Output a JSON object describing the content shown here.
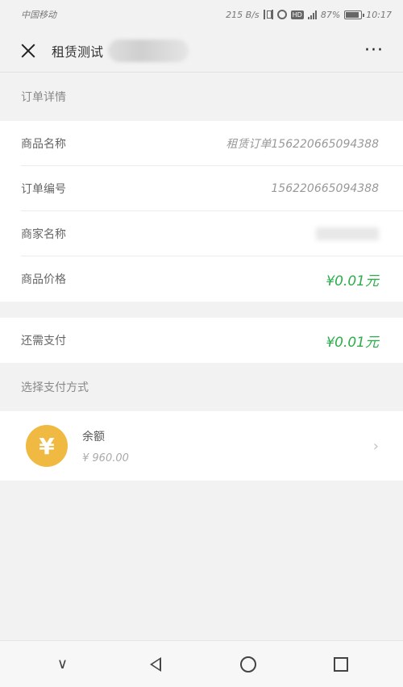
{
  "statusbar": {
    "carrier": "中国移动",
    "speed": "215 B/s",
    "battery": "87%",
    "time": "10:17",
    "icons": [
      "vibrate-icon",
      "alarm-icon",
      "hd-icon",
      "signal-icon",
      "battery-icon"
    ]
  },
  "titlebar": {
    "title": "租赁测试",
    "close_icon": "close-icon",
    "more_label": "···"
  },
  "order": {
    "section_title": "订单详情",
    "rows": [
      {
        "label": "商品名称",
        "value": "租赁订单156220665094388"
      },
      {
        "label": "订单编号",
        "value": "156220665094388"
      },
      {
        "label": "商家名称",
        "value": ""
      },
      {
        "label": "商品价格",
        "value": "¥0.01元"
      }
    ]
  },
  "payment_due": {
    "label": "还需支付",
    "value": "¥0.01元"
  },
  "methods": {
    "section_title": "选择支付方式",
    "items": [
      {
        "icon": "yuan-coin-icon",
        "symbol": "¥",
        "name": "余额",
        "amount": "¥ 960.00"
      }
    ]
  },
  "colors": {
    "accent_green": "#2aae4a",
    "coin_gold": "#f0b941",
    "background": "#f2f2f2"
  }
}
